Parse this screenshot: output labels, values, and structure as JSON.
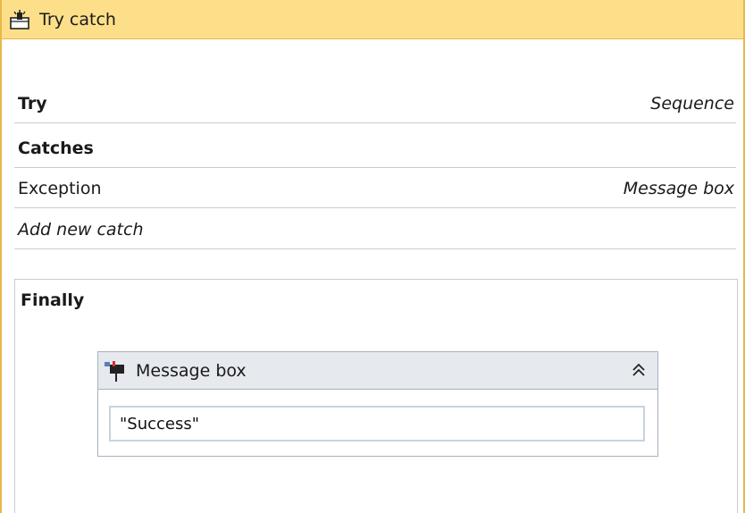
{
  "activity": {
    "title": "Try catch",
    "icon": "try-catch-icon",
    "header_color": "#fddf8a",
    "border_color": "#e8b84a"
  },
  "try_row": {
    "label": "Try",
    "value": "Sequence"
  },
  "catches": {
    "label": "Catches",
    "items": [
      {
        "label": "Exception",
        "value": "Message box"
      }
    ],
    "add_new": "Add new catch"
  },
  "finally": {
    "label": "Finally",
    "message_box": {
      "title": "Message box",
      "icon": "message-box-icon",
      "collapse_icon": "double-chevron-up-icon",
      "text_value": "\"Success\""
    }
  }
}
